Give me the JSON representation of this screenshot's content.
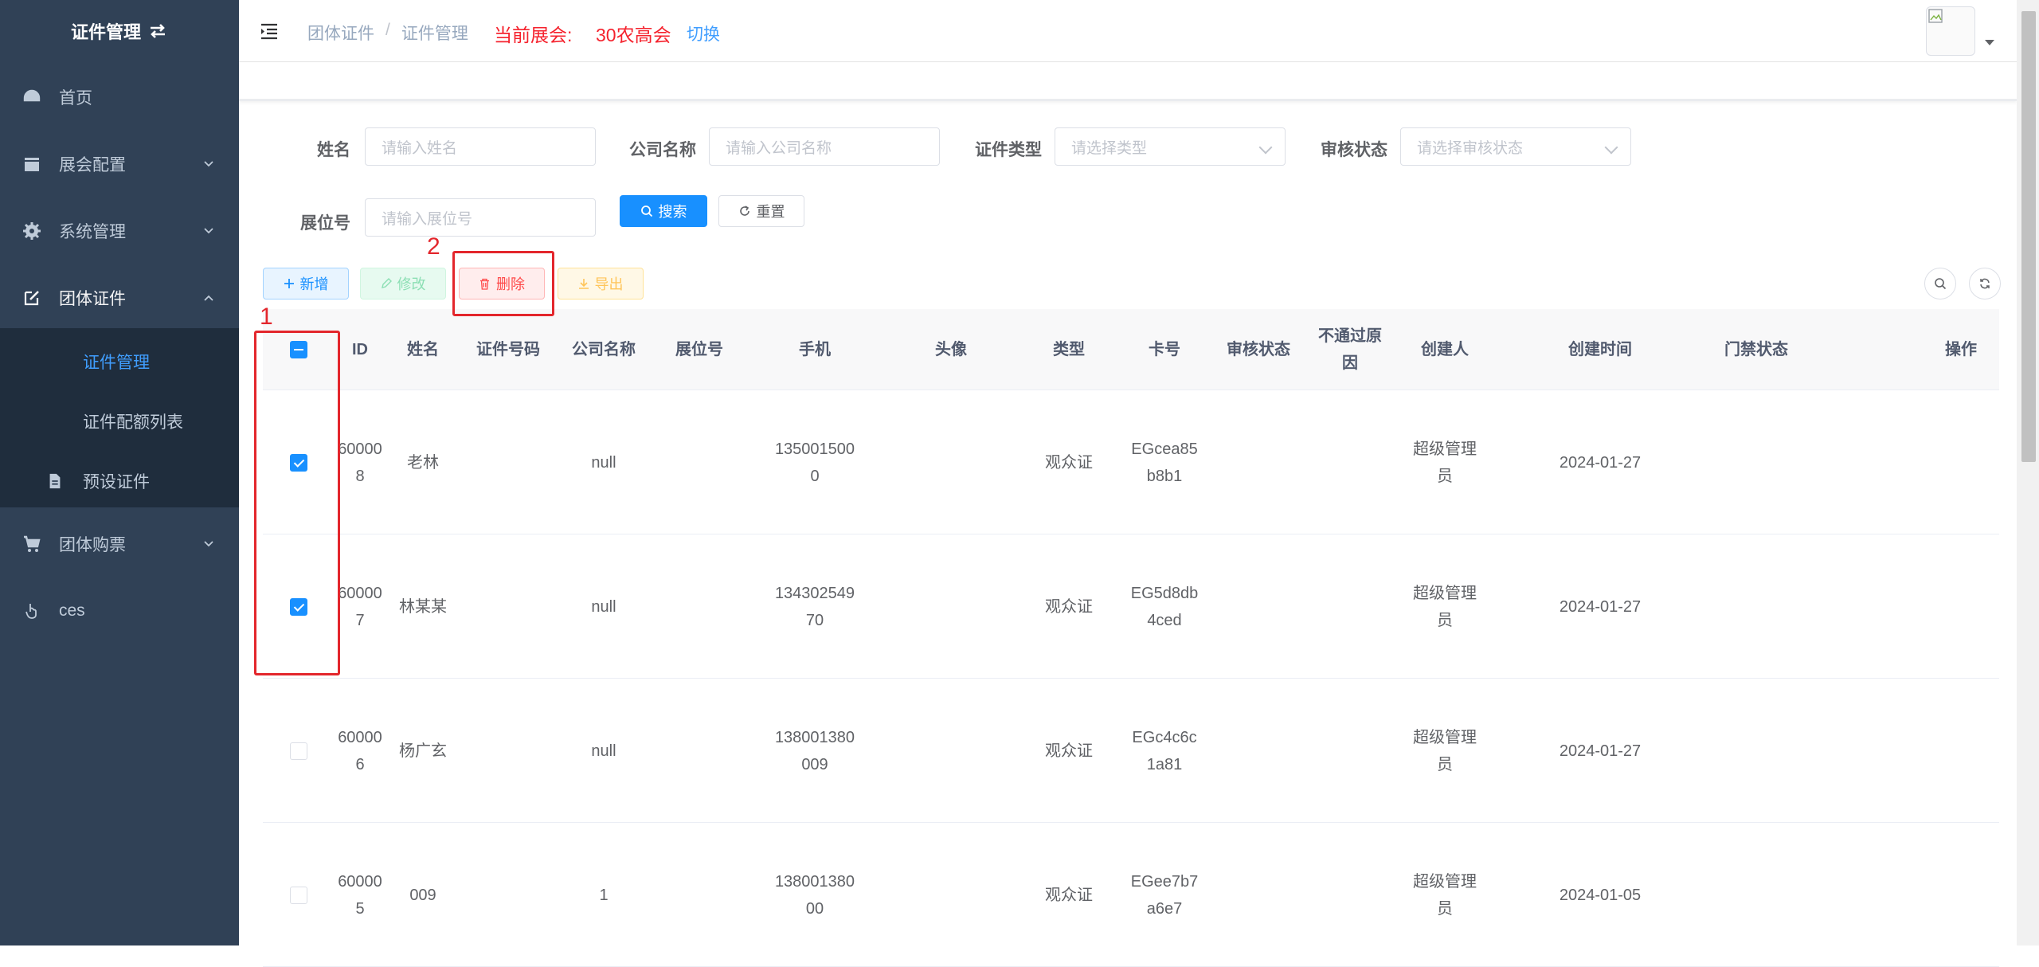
{
  "sidebar": {
    "title": "证件管理",
    "items": [
      {
        "label": "首页"
      },
      {
        "label": "展会配置"
      },
      {
        "label": "系统管理"
      },
      {
        "label": "团体证件"
      },
      {
        "label": "团体购票"
      },
      {
        "label": "ces"
      }
    ],
    "subitems": [
      {
        "label": "证件管理"
      },
      {
        "label": "证件配额列表"
      },
      {
        "label": "预设证件"
      }
    ]
  },
  "navbar": {
    "breadcrumb": [
      "团体证件",
      "证件管理"
    ],
    "breadcrumb_sep": "/",
    "expo_label": "当前展会:",
    "expo_name": "30农高会",
    "switch_label": "切换"
  },
  "search": {
    "name_label": "姓名",
    "name_placeholder": "请输入姓名",
    "company_label": "公司名称",
    "company_placeholder": "请输入公司名称",
    "type_label": "证件类型",
    "type_placeholder": "请选择类型",
    "status_label": "审核状态",
    "status_placeholder": "请选择审核状态",
    "booth_label": "展位号",
    "booth_placeholder": "请输入展位号",
    "search_btn": "搜索",
    "reset_btn": "重置"
  },
  "toolbar": {
    "add": "新增",
    "edit": "修改",
    "delete": "删除",
    "export": "导出"
  },
  "table": {
    "headers": [
      "ID",
      "姓名",
      "证件号码",
      "公司名称",
      "展位号",
      "手机",
      "头像",
      "类型",
      "卡号",
      "审核状态",
      "不通过原因",
      "创建人",
      "创建时间",
      "门禁状态",
      "操作"
    ],
    "rows": [
      {
        "checked": true,
        "id": "600008",
        "name": "老林",
        "id_no": "",
        "company": "null",
        "booth": "",
        "phone": "1350015000",
        "avatar": "",
        "type": "观众证",
        "card": "EGcea85b8b1",
        "status": "",
        "reason": "",
        "creator": "超级管理员",
        "created": "2024-01-27",
        "access": ""
      },
      {
        "checked": true,
        "id": "600007",
        "name": "林某某",
        "id_no": "",
        "company": "null",
        "booth": "",
        "phone": "13430254970",
        "avatar": "",
        "type": "观众证",
        "card": "EG5d8db4ced",
        "status": "",
        "reason": "",
        "creator": "超级管理员",
        "created": "2024-01-27",
        "access": ""
      },
      {
        "checked": false,
        "id": "600006",
        "name": "杨广玄",
        "id_no": "",
        "company": "null",
        "booth": "",
        "phone": "138001380009",
        "avatar": "",
        "type": "观众证",
        "card": "EGc4c6c1a81",
        "status": "",
        "reason": "",
        "creator": "超级管理员",
        "created": "2024-01-27",
        "access": ""
      },
      {
        "checked": false,
        "id": "600005",
        "name": "009",
        "id_no": "",
        "company": "1",
        "booth": "",
        "phone": "13800138000",
        "avatar": "",
        "type": "观众证",
        "card": "EGee7b7a6e7",
        "status": "",
        "reason": "",
        "creator": "超级管理员",
        "created": "2024-01-05",
        "access": ""
      }
    ]
  },
  "annotations": [
    "1",
    "2"
  ],
  "colors": {
    "sidebar_bg": "#304156",
    "primary": "#1890ff",
    "danger": "#ff4949",
    "annotation": "#e3262c"
  }
}
